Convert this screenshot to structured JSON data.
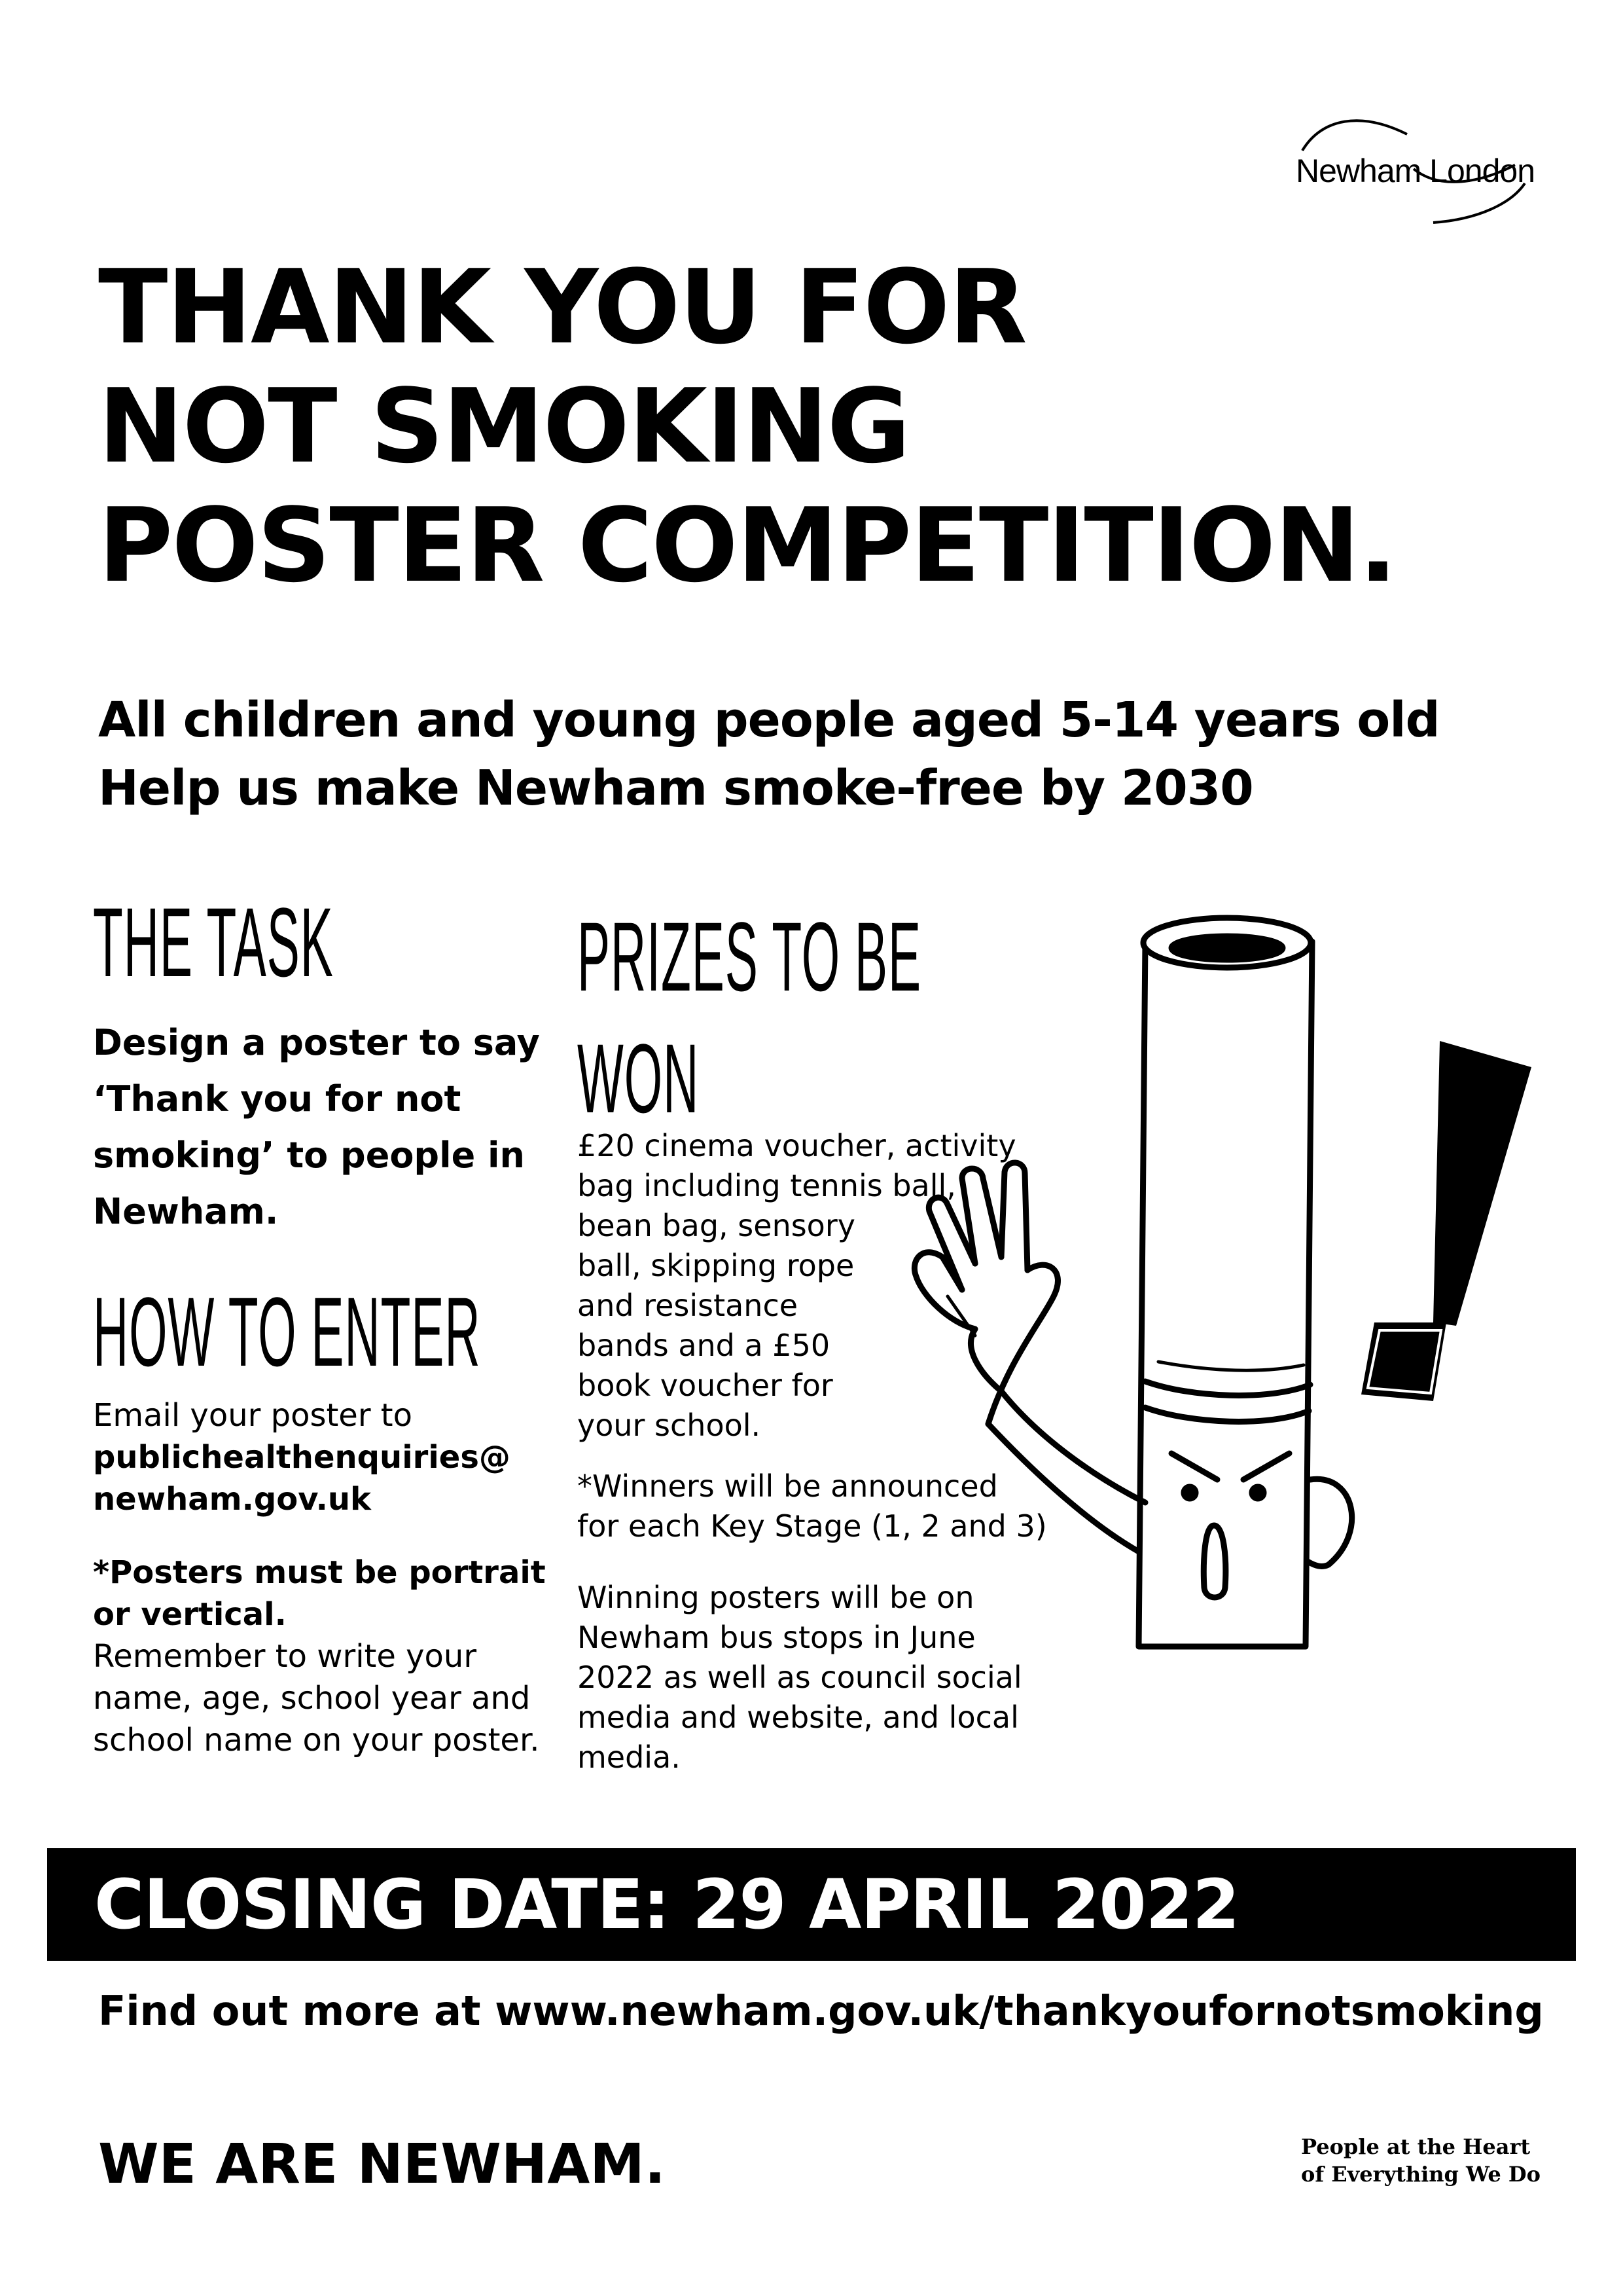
{
  "logo": {
    "text": "Newham London"
  },
  "title": {
    "line1": "THANK YOU FOR",
    "line2": "NOT SMOKING",
    "line3": "POSTER COMPETITION."
  },
  "subtitle": {
    "line1": "All children and young people aged 5-14 years old",
    "line2": "Help us make Newham smoke-free by 2030"
  },
  "task": {
    "heading": "THE TASK",
    "body": "Design a poster to say ‘Thank you for not smoking’ to people in Newham."
  },
  "how_to_enter": {
    "heading": "HOW TO ENTER",
    "line1": "Email your poster to",
    "email": "publichealthenquiries@ newham.gov.uk",
    "note_bold": "*Posters must be portrait or vertical.",
    "note": "Remember to write your name, age, school year and school name on your poster."
  },
  "prizes": {
    "heading_line1": "PRIZES TO BE",
    "heading_line2": "WON",
    "lines": [
      "£20 cinema voucher, activity",
      "bag including tennis ball,",
      "bean bag, sensory",
      "ball, skipping rope",
      "and resistance",
      "bands and a £50",
      "book voucher for",
      "your school."
    ],
    "winners": "*Winners will be announced for each Key Stage (1, 2 and 3)",
    "winning": "Winning posters will be on Newham bus stops in June 2022 as well as council social media and website, and local media."
  },
  "closing": {
    "text": "CLOSING DATE:  29 APRIL 2022"
  },
  "find_more": "Find out more at www.newham.gov.uk/thankyoufornotsmoking",
  "footer": {
    "we_are": "WE ARE NEWHAM.",
    "tagline_line1": "People at the Heart",
    "tagline_line2": "of Everything We Do"
  },
  "colors": {
    "ink": "#000000",
    "paper": "#ffffff"
  },
  "illustration": {
    "icon": "cigarette-character-with-exclamation-mark"
  }
}
